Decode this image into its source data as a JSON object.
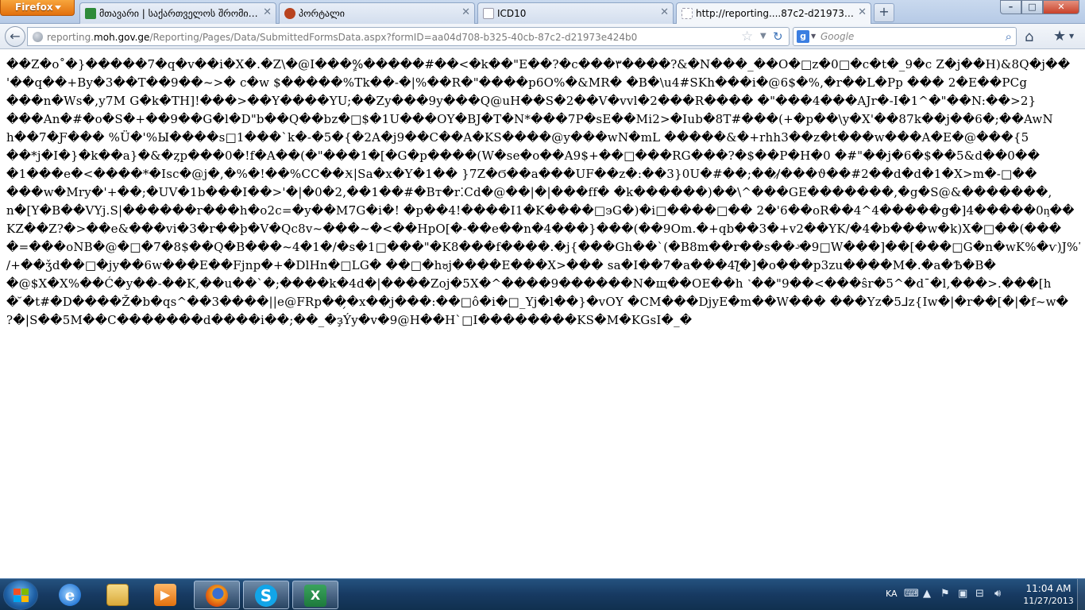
{
  "browser": {
    "menu_button_label": "Firefox",
    "tabs": [
      {
        "label": "მთავარი  | საქართველოს შრომის, ...",
        "favicon_color": "#2e8b3a"
      },
      {
        "label": "პორტალი",
        "favicon_color": "#b8431f"
      },
      {
        "label": "ICD10",
        "favicon_color": "#ffffff"
      },
      {
        "label": "http://reporting....87c2-d21973e424b0",
        "favicon_color": "#ffffff"
      }
    ],
    "new_tab_label": "+",
    "window_controls": {
      "minimize": "–",
      "maximize": "□",
      "close": "✕"
    }
  },
  "navbar": {
    "back_glyph": "←",
    "url_prefix": "reporting.",
    "url_domain": "moh.gov.ge",
    "url_path": "/Reporting/Pages/Data/SubmittedFormsData.aspx?formID=aa04d708-b325-40cb-87c2-d21973e424b0",
    "search_engine_letter": "g",
    "search_placeholder": "Google"
  },
  "content": {
    "lines": [
      "��Z�o˚�}�����7�q�v��i�X�.�Z\\�@I���%ٍ�����#��<�k��\"E��?�c���٣����?&�N���_��O�□z�0□�c�t�_9�c Z�j��H)&8Q�j��",
      "'��q��+By�3��T��9��~>� c�w $�����%Tk��-�|%��R�\"����p6O%�&MR� �B�\\u4#SKh���i�@6$�%,�r��L�Pp ��� 2�E��PCg",
      "���n�Ws�,y7M G�k�TH]!���>��Y����YU;��Zy���9y���Q@uH��S�2��V�vvl�2���R���� �\"���4���AJr�-I�1^�\"��N:��>2}",
      "���An�#�o�S�+��9��G�l�D\"b��Q��bz�□$�1U���OY�BJ�T�N*���7P�sE��Mi2>�Iub�8T#���(+�p��\\y�X'��87k��j��6�;��AwN",
      "h��7�Ƒ��� %Ü�'%Ы����s□1���`k�-�5�{�2A�j9��C��A�KS����@y���wN�mL �����&�+rhh3��z�t���w���A�E�@���{5",
      "��*j�I�}�k��a}�&�ȥp���0�!f�A��(�\"���1�[�G�p����(W�se�o��A9$+��□���RG���?�$��P�H�0 �#\"��j�6�$��5&d��0��",
      "�1���e�<����*�Isc�@j�,�%�!��%CC��Ӿ|Sa�x�Y�1�� }7Z�Ϭ��a���UF��z�:��3}0U�#��;��/̷���ϑ��#2��d�d�1�X>m�-□��",
      "���w�Mry�'+��;�UV�1b���I��>'�|�0�2,��1��#�Bт�r⁚Cd�@��|�|���ff� �k������)��\\^���GE�������,�g�S@&�������,",
      "n�[Y�B��VYj.S|������r���h�o2c=�y��M7G�i�! �p��4!����I1�K����□эG�)�i□����□�� 2�'6��oR��4^4�����g�]4�����0ᶇ��",
      "KZ��Z?�>��e&���vi�3�r��þ�V�Qc8v~���~�<��HpO[�-��e��n�4���}���(��9Om.�+qb��3�+v2��YK/�4�b���w�k)X�□��(���",
      "�=���oNB�@�□�7�8$��Q�B���~4�1�/�s�1□���\"�K8���f����.�j{���Gh��`(�B8m��r��s��-ͮ�9□W���]��[���□G�n�wK%�ѵ)J%7�",
      "/+��ǯd��□�jy��6w���E��Fjnp�+�DlHn�□LG� ��□�hჾj����E���X>��� sa�I��7�a���4ƪ�]�o���p3zu����M�.�a�Ѣ�B�",
      "�@$X�X%��Ć�y��-��K,��u��`�;����k�4d�|����Zoj�5X�^����9������N�щ��OE��h ˺��\"9��<���ŝr�5^�dˉ�l,���>.���[h",
      "� ̆�t#�D����Ž�b�qs^��3����||e@FRp��̗�x��j���:��□ô�i�□_Yj�l��}�vOY �CM���DjyE�m��W��� ���Yz�5⅃z{Iw�|�r��[�|�f~w�",
      "?�|S��5M��C�������d����i��;��_�ҙÝy�v�9@H��H`□I��������KS�M�KGsI�_�"
    ]
  },
  "taskbar": {
    "pinned": [
      {
        "name": "internet-explorer-icon",
        "color": "#2b7cd8"
      },
      {
        "name": "windows-explorer-icon",
        "color": "#e8c25a"
      },
      {
        "name": "media-player-icon",
        "color": "#f08a1c"
      },
      {
        "name": "firefox-icon",
        "color": "#e86a14",
        "active": true
      },
      {
        "name": "skype-icon",
        "color": "#12a5e8",
        "active": true
      },
      {
        "name": "excel-icon",
        "color": "#1d7a3c",
        "active": true
      }
    ],
    "tray": {
      "language": "KA",
      "time": "11:04 AM",
      "date": "11/27/2013"
    }
  }
}
